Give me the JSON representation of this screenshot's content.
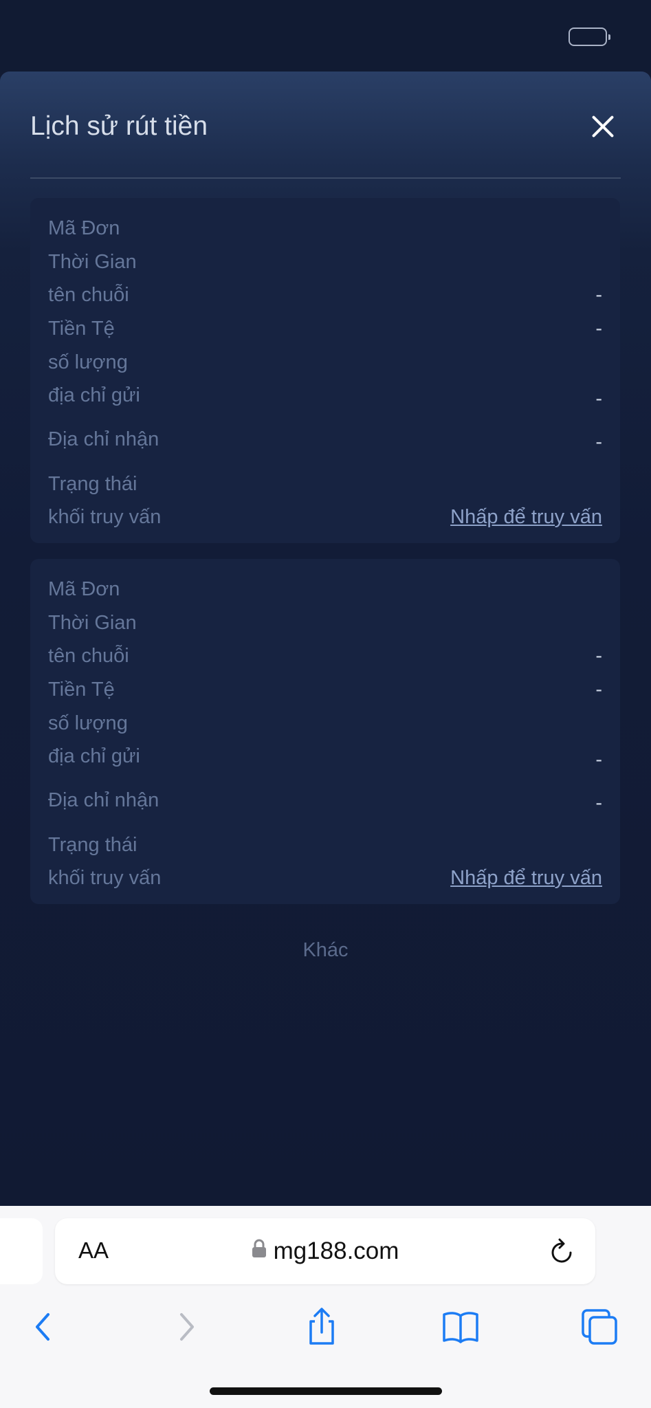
{
  "modal": {
    "title": "Lịch sử rút tiền",
    "close_icon": "close-icon"
  },
  "records": [
    {
      "order_label": "Mã Đơn",
      "order_value": "",
      "time_label": "Thời Gian",
      "time_value": "",
      "chain_label": "tên chuỗi",
      "chain_value": "-",
      "currency_label": "Tiền Tệ",
      "currency_value": "-",
      "amount_label": "số lượng",
      "amount_value": "",
      "from_label": "địa chỉ gửi",
      "from_value": "-",
      "to_label": "Địa chỉ nhận",
      "to_value": "-",
      "status_label": "Trạng thái",
      "status_value": "",
      "block_label": "khối truy vấn",
      "block_link": "Nhấp để truy vấn"
    },
    {
      "order_label": "Mã Đơn",
      "order_value": "",
      "time_label": "Thời Gian",
      "time_value": "",
      "chain_label": "tên chuỗi",
      "chain_value": "-",
      "currency_label": "Tiền Tệ",
      "currency_value": "-",
      "amount_label": "số lượng",
      "amount_value": "",
      "from_label": "địa chỉ gửi",
      "from_value": "-",
      "to_label": "Địa chỉ nhận",
      "to_value": "-",
      "status_label": "Trạng thái",
      "status_value": "",
      "block_label": "khối truy vấn",
      "block_link": "Nhấp để truy vấn"
    }
  ],
  "more_label": "Khác",
  "browser": {
    "text_size_label": "AA",
    "domain": "mg188.com",
    "icons": {
      "lock": "lock-icon",
      "reload": "reload-icon",
      "back": "back-icon",
      "forward": "forward-icon",
      "share": "share-icon",
      "bookmarks": "bookmarks-icon",
      "tabs": "tabs-icon"
    },
    "accent": "#1c7cf4"
  }
}
